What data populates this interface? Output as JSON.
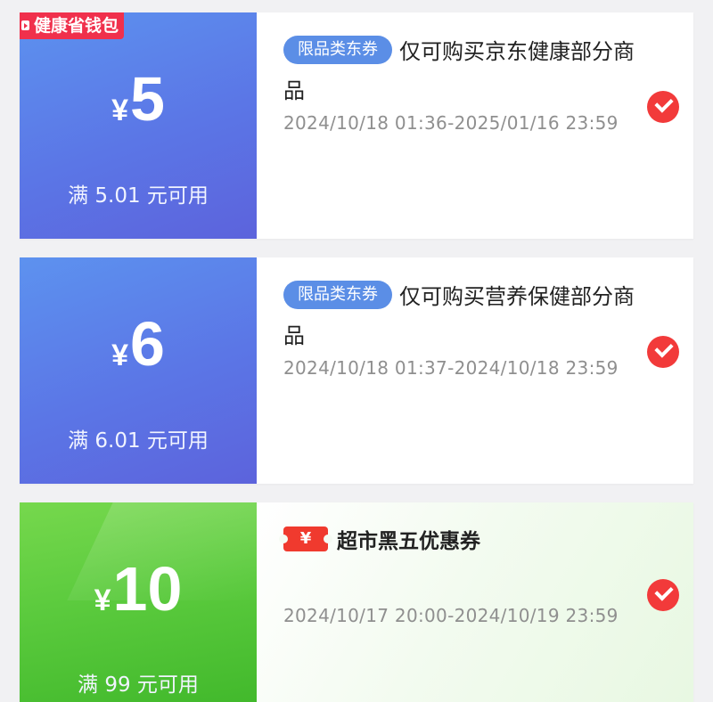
{
  "coupons": [
    {
      "badge": "健康省钱包",
      "currency": "¥",
      "amount": "5",
      "threshold": "满 5.01 元可用",
      "type_tag": "限品类东券",
      "description": "仅可购买京东健康部分商品",
      "validity": "2024/10/18 01:36-2025/01/16 23:59",
      "selected": true
    },
    {
      "currency": "¥",
      "amount": "6",
      "threshold": "满 6.01 元可用",
      "type_tag": "限品类东券",
      "description": "仅可购买营养保健部分商品",
      "validity": "2024/10/18 01:37-2024/10/18 23:59",
      "selected": true
    },
    {
      "currency": "¥",
      "amount": "10",
      "threshold": "满 99 元可用",
      "icon_label": "¥",
      "title": "超市黑五优惠券",
      "validity": "2024/10/17 20:00-2024/10/19 23:59",
      "selected": true
    }
  ],
  "colors": {
    "blue_start": "#5d92ef",
    "blue_end": "#5c63dc",
    "green_start": "#76d84d",
    "green_end": "#42b92c",
    "check_red": "#f23a3a",
    "tag_blue": "#5b8ee6",
    "badge_red": "#f0304c"
  }
}
